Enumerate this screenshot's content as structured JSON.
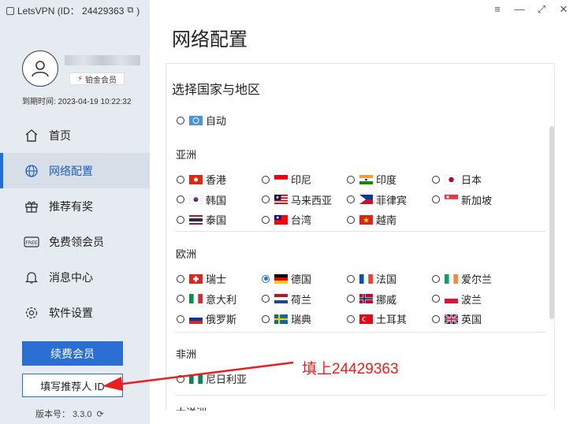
{
  "app": {
    "title": "LetsVPN (ID： 24429363",
    "title_tail": ")"
  },
  "window_controls": {
    "menu": "≡",
    "minimize": "—",
    "maximize": "⤢",
    "close": "✕"
  },
  "user": {
    "badge": "铂金会员",
    "expire": "到期时间: 2023-04-19 10:22:32"
  },
  "nav": {
    "home": "首页",
    "network": "网络配置",
    "referral": "推荐有奖",
    "free": "免费领会员",
    "messages": "消息中心",
    "settings": "软件设置"
  },
  "buttons": {
    "renew": "续费会员",
    "referrer": "填写推荐人 ID"
  },
  "version": {
    "label": "版本号： 3.3.0"
  },
  "main": {
    "title": "网络配置",
    "section": "选择国家与地区",
    "auto": "自动",
    "groups": {
      "asia": "亚洲",
      "europe": "欧洲",
      "africa": "非洲",
      "oceania": "大洋洲"
    },
    "asia": [
      "香港",
      "印尼",
      "印度",
      "日本",
      "韩国",
      "马来西亚",
      "菲律宾",
      "新加坡",
      "泰国",
      "台湾",
      "越南"
    ],
    "europe": [
      "瑞士",
      "德国",
      "法国",
      "爱尔兰",
      "意大利",
      "荷兰",
      "挪威",
      "波兰",
      "俄罗斯",
      "瑞典",
      "土耳其",
      "英国"
    ],
    "africa": [
      "尼日利亚"
    ],
    "selected": "德国"
  },
  "annotation": {
    "text": "填上24429363",
    "color": "#e81f1f"
  },
  "colors": {
    "accent": "#2a6fd1",
    "sidebar": "#e6ebf1"
  }
}
